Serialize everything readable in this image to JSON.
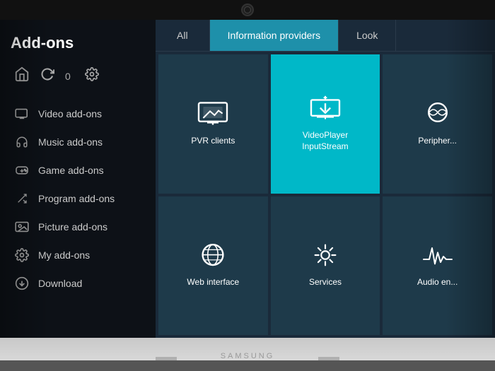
{
  "page": {
    "title": "Add-ons"
  },
  "camera": {
    "label": "webcam"
  },
  "sidebar": {
    "title": "Add-ons",
    "icons": {
      "box_icon": "📦",
      "refresh_icon": "↺",
      "count": "0",
      "gear_icon": "⚙"
    },
    "nav_items": [
      {
        "id": "video-addons",
        "label": "Video add-ons",
        "icon": "video"
      },
      {
        "id": "music-addons",
        "label": "Music add-ons",
        "icon": "music"
      },
      {
        "id": "game-addons",
        "label": "Game add-ons",
        "icon": "game"
      },
      {
        "id": "program-addons",
        "label": "Program add-ons",
        "icon": "program"
      },
      {
        "id": "picture-addons",
        "label": "Picture add-ons",
        "icon": "picture"
      },
      {
        "id": "my-addons",
        "label": "My add-ons",
        "icon": "myaddons"
      },
      {
        "id": "download",
        "label": "Download",
        "icon": "download"
      }
    ]
  },
  "tabs": [
    {
      "id": "all",
      "label": "All",
      "active": false
    },
    {
      "id": "information-providers",
      "label": "Information providers",
      "active": true
    },
    {
      "id": "look",
      "label": "Look",
      "active": false
    }
  ],
  "grid": {
    "cells": [
      {
        "id": "pvr-clients",
        "label": "PVR clients",
        "icon": "pvr",
        "active": false
      },
      {
        "id": "videoplayer-inputstream",
        "label": "VideoPlayer\nInputStream",
        "icon": "videoplayer",
        "active": true
      },
      {
        "id": "peripheral",
        "label": "Peripher...",
        "icon": "peripheral",
        "active": false,
        "partial": true
      },
      {
        "id": "web-interface",
        "label": "Web interface",
        "icon": "web",
        "active": false
      },
      {
        "id": "services",
        "label": "Services",
        "icon": "services",
        "active": false
      },
      {
        "id": "audio-encoder",
        "label": "Audio en...",
        "icon": "audio",
        "active": false,
        "partial": true
      }
    ]
  }
}
